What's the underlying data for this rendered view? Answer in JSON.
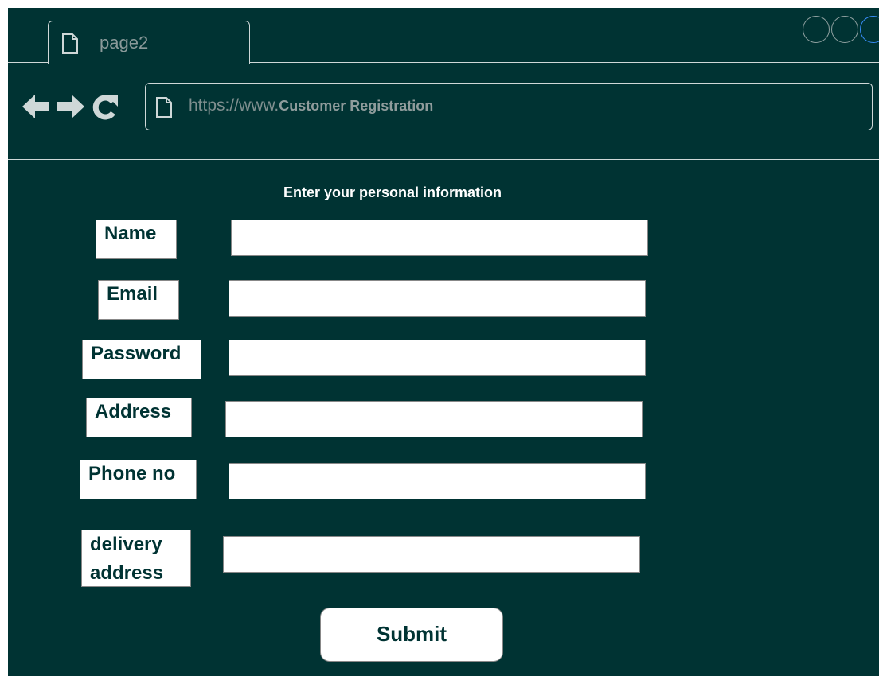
{
  "browser": {
    "tab_title": "page2",
    "url_prefix": "https://www.",
    "url_title": "Customer Registration",
    "icons": [
      "page-icon",
      "back-arrow-icon",
      "forward-arrow-icon",
      "reload-icon"
    ]
  },
  "form": {
    "heading": "Enter your personal information",
    "fields": {
      "name": {
        "label": "Name",
        "value": ""
      },
      "email": {
        "label": "Email",
        "value": ""
      },
      "password": {
        "label": "Password",
        "value": ""
      },
      "address": {
        "label": "Address",
        "value": ""
      },
      "phone": {
        "label": "Phone no",
        "value": ""
      },
      "delivery": {
        "label_line1": "delivery",
        "label_line2": "address",
        "value": ""
      }
    },
    "submit_label": "Submit"
  },
  "colors": {
    "background": "#003333",
    "foreground_text": "#ffffff",
    "window_control_active": "#3a90ff"
  }
}
